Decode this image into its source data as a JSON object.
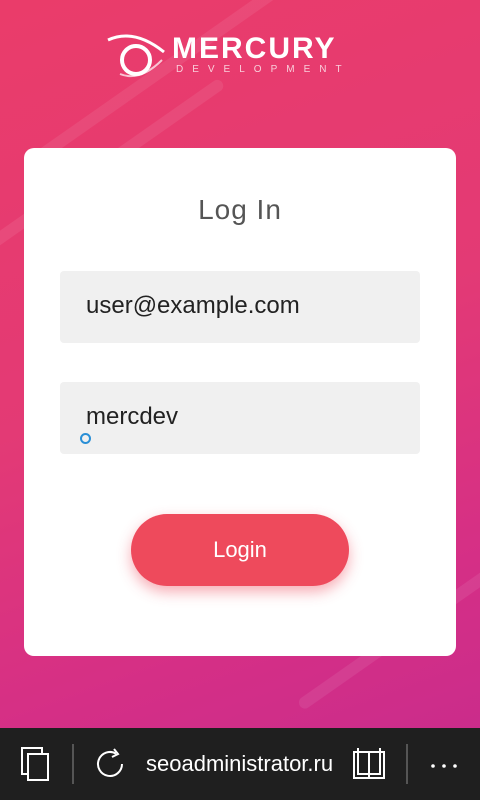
{
  "brand": {
    "name": "MERCURY",
    "subtitle": "DEVELOPMENT"
  },
  "login_card": {
    "title": "Log In",
    "email_value": "user@example.com",
    "password_value": "mercdev",
    "login_button_label": "Login"
  },
  "browser_bar": {
    "url": "seoadministrator.ru",
    "icons": [
      "tabs-icon",
      "refresh-icon",
      "reading-view-icon",
      "more-icon"
    ]
  },
  "colors": {
    "background_start": "#ea3c6a",
    "background_end": "#c62b8d",
    "button": "#ee4a5c",
    "field_bg": "#f0f0f0",
    "bottom_bar": "#1f1f1f"
  }
}
